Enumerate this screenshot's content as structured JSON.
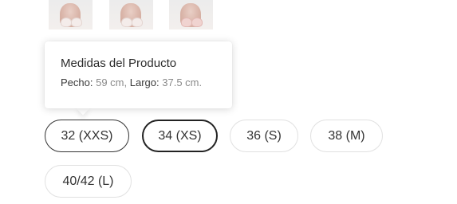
{
  "thumbnails": [
    {
      "name": "product-thumbnail-1"
    },
    {
      "name": "product-thumbnail-2"
    },
    {
      "name": "product-thumbnail-3"
    }
  ],
  "tooltip": {
    "title": "Medidas del Producto",
    "pecho_label": "Pecho:",
    "pecho_value": "59 cm,",
    "largo_label": "Largo:",
    "largo_value": "37.5 cm."
  },
  "sizes": {
    "selected": "34 (XS)",
    "hovered": "32 (XXS)",
    "options": [
      "32 (XXS)",
      "34 (XS)",
      "36 (S)",
      "38 (M)",
      "40/42 (L)"
    ]
  },
  "colors": {
    "selected_border": "#222222",
    "default_border": "#e1e1e1",
    "muted_value": "#8a8a8a"
  }
}
